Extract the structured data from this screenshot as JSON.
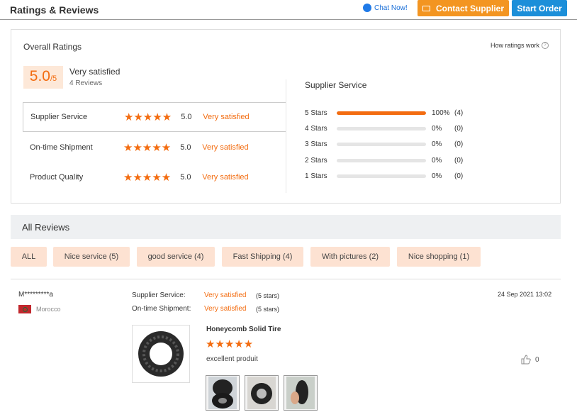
{
  "header": {
    "title": "Ratings & Reviews",
    "chat_label": "Chat Now!",
    "contact_label": "Contact Supplier",
    "order_label": "Start Order"
  },
  "overall": {
    "title": "Overall Ratings",
    "how_label": "How ratings work",
    "score": "5.0",
    "score_max": "/5",
    "satisfaction": "Very satisfied",
    "review_count": "4 Reviews",
    "categories": [
      {
        "label": "Supplier Service",
        "score": "5.0",
        "text": "Very satisfied",
        "stars": 5
      },
      {
        "label": "On-time Shipment",
        "score": "5.0",
        "text": "Very satisfied",
        "stars": 5
      },
      {
        "label": "Product Quality",
        "score": "5.0",
        "text": "Very satisfied",
        "stars": 5
      }
    ]
  },
  "breakdown": {
    "title": "Supplier Service",
    "rows": [
      {
        "label": "5 Stars",
        "pct": "100%",
        "count": "(4)",
        "fill": 1.0
      },
      {
        "label": "4 Stars",
        "pct": "0%",
        "count": "(0)",
        "fill": 0
      },
      {
        "label": "3 Stars",
        "pct": "0%",
        "count": "(0)",
        "fill": 0
      },
      {
        "label": "2 Stars",
        "pct": "0%",
        "count": "(0)",
        "fill": 0
      },
      {
        "label": "1 Stars",
        "pct": "0%",
        "count": "(0)",
        "fill": 0
      }
    ]
  },
  "all_reviews": {
    "title": "All Reviews",
    "tags": [
      "ALL",
      "Nice service (5)",
      "good service (4)",
      "Fast Shipping (4)",
      "With pictures (2)",
      "Nice shopping (1)"
    ]
  },
  "review": {
    "reviewer": "M*********a",
    "country": "Morocco",
    "supplier_service_label": "Supplier Service:",
    "supplier_service_value": "Very satisfied",
    "supplier_service_stars": "(5 stars)",
    "shipment_label": "On-time Shipment:",
    "shipment_value": "Very satisfied",
    "shipment_stars": "(5 stars)",
    "date": "24 Sep 2021 13:02",
    "product_name": "Honeycomb Solid Tire",
    "product_stars": 5,
    "comment": "excellent produit",
    "likes": "0"
  },
  "colors": {
    "accent": "#f36c10",
    "contact_btn": "#f39521",
    "order_btn": "#1c8fd9",
    "tag_bg": "#fde2d2"
  }
}
